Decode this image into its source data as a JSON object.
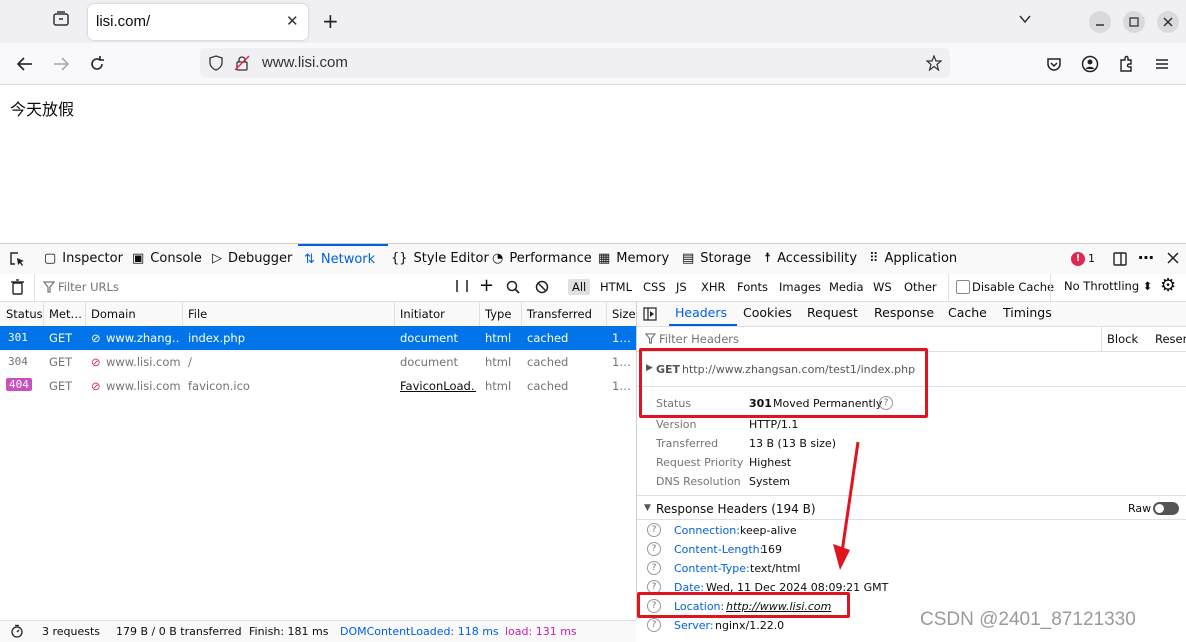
{
  "browser": {
    "tab_title": "lisi.com/",
    "tab_close": "✕",
    "url": "www.lisi.com"
  },
  "page": {
    "text": "今天放假"
  },
  "devtools": {
    "tabs": [
      "Inspector",
      "Console",
      "Debugger",
      "Network",
      "Style Editor",
      "Performance",
      "Memory",
      "Storage",
      "Accessibility",
      "Application"
    ],
    "error_count": "1",
    "filter_placeholder": "Filter URLs",
    "filter_types": [
      "All",
      "HTML",
      "CSS",
      "JS",
      "XHR",
      "Fonts",
      "Images",
      "Media",
      "WS",
      "Other"
    ],
    "disable_cache": "Disable Cache",
    "throttling": "No Throttling ⬍",
    "columns": [
      "Status",
      "Met…",
      "Domain",
      "File",
      "Initiator",
      "Type",
      "Transferred",
      "Size"
    ],
    "requests": [
      {
        "status": "301",
        "method": "GET",
        "domain": "www.zhang…",
        "file": "index.php",
        "initiator": "document",
        "type": "html",
        "transferred": "cached",
        "size": "1…"
      },
      {
        "status": "304",
        "method": "GET",
        "domain": "www.lisi.com",
        "file": "/",
        "initiator": "document",
        "type": "html",
        "transferred": "cached",
        "size": "1…"
      },
      {
        "status": "404",
        "method": "GET",
        "domain": "www.lisi.com",
        "file": "favicon.ico",
        "initiator": "FaviconLoad…",
        "type": "html",
        "transferred": "cached",
        "size": "1…"
      }
    ],
    "statusbar": {
      "requests": "3 requests",
      "transferred": "179 B / 0 B transferred",
      "finish": "Finish: 181 ms",
      "dcl": "DOMContentLoaded: 118 ms",
      "load": "load: 131 ms"
    },
    "side_tabs": [
      "Headers",
      "Cookies",
      "Request",
      "Response",
      "Cache",
      "Timings"
    ],
    "filter_headers": "Filter Headers",
    "block": "Block",
    "resend": "Resend",
    "request_line": {
      "method": "GET",
      "url": "http://www.zhangsan.com/test1/index.php"
    },
    "summary": [
      {
        "label": "Status",
        "value": "Moved Permanently",
        "code": "301"
      },
      {
        "label": "Version",
        "value": "HTTP/1.1"
      },
      {
        "label": "Transferred",
        "value": "13 B (13 B size)"
      },
      {
        "label": "Request Priority",
        "value": "Highest"
      },
      {
        "label": "DNS Resolution",
        "value": "System"
      }
    ],
    "response_headers_title": "Response Headers (194 B)",
    "raw": "Raw",
    "response_headers": [
      {
        "name": "Connection:",
        "value": "keep-alive"
      },
      {
        "name": "Content-Length:",
        "value": "169"
      },
      {
        "name": "Content-Type:",
        "value": "text/html"
      },
      {
        "name": "Date:",
        "value": "Wed, 11 Dec 2024 08:09:21 GMT"
      },
      {
        "name": "Location:",
        "value": "http://www.lisi.com"
      },
      {
        "name": "Server:",
        "value": "nginx/1.22.0"
      }
    ]
  },
  "watermark": "CSDN @2401_87121330",
  "colors": {
    "accent": "#0060df",
    "selected_row": "#0074e8",
    "annotation": "#e0141e",
    "badge_404": "#c850c0"
  }
}
